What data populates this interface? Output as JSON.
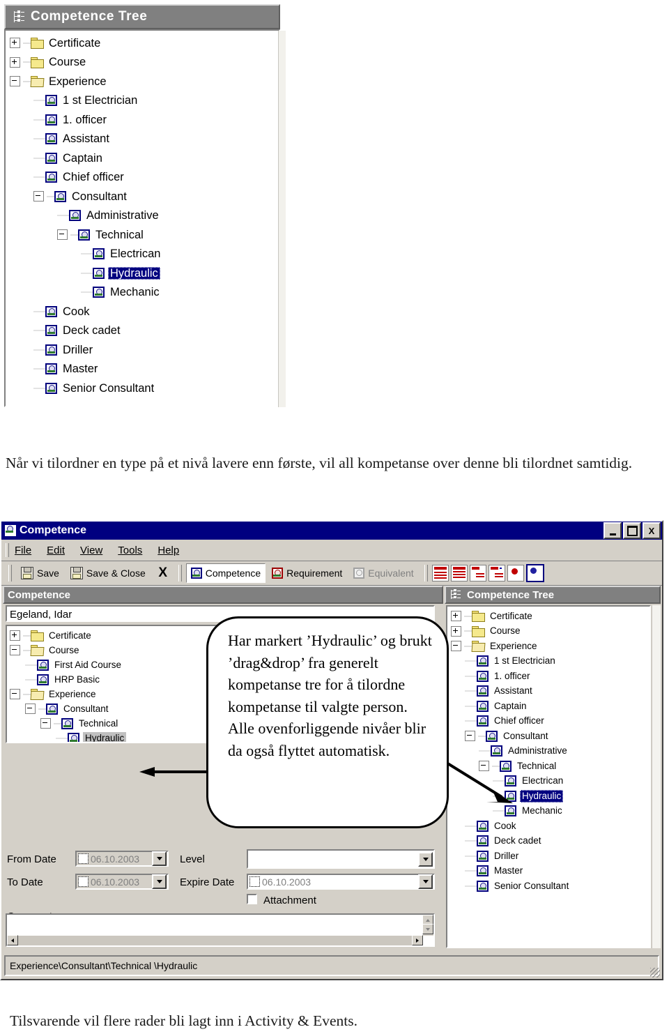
{
  "top_tree_panel": {
    "title": "Competence Tree",
    "title_icon": "tree-outline-icon",
    "nodes": [
      {
        "label": "Certificate",
        "icon": "folder-icon",
        "toggle": "plus",
        "depth": 0
      },
      {
        "label": "Course",
        "icon": "folder-icon",
        "toggle": "plus",
        "depth": 0
      },
      {
        "label": "Experience",
        "icon": "folder-open-icon",
        "toggle": "minus",
        "depth": 0
      },
      {
        "label": "1 st Electrician",
        "icon": "competence-icon",
        "toggle": "none",
        "depth": 1
      },
      {
        "label": "1. officer",
        "icon": "competence-icon",
        "toggle": "none",
        "depth": 1
      },
      {
        "label": "Assistant",
        "icon": "competence-icon",
        "toggle": "none",
        "depth": 1
      },
      {
        "label": "Captain",
        "icon": "competence-icon",
        "toggle": "none",
        "depth": 1
      },
      {
        "label": "Chief officer",
        "icon": "competence-icon",
        "toggle": "none",
        "depth": 1
      },
      {
        "label": "Consultant",
        "icon": "competence-icon",
        "toggle": "minus",
        "depth": 1
      },
      {
        "label": "Administrative",
        "icon": "competence-icon",
        "toggle": "none",
        "depth": 2
      },
      {
        "label": "Technical",
        "icon": "competence-icon",
        "toggle": "minus",
        "depth": 2
      },
      {
        "label": "Electrican",
        "icon": "competence-icon",
        "toggle": "none",
        "depth": 3
      },
      {
        "label": "Hydraulic",
        "icon": "competence-icon",
        "toggle": "none",
        "depth": 3,
        "selected": true
      },
      {
        "label": "Mechanic",
        "icon": "competence-icon",
        "toggle": "none",
        "depth": 3
      },
      {
        "label": "Cook",
        "icon": "competence-icon",
        "toggle": "none",
        "depth": 1
      },
      {
        "label": "Deck cadet",
        "icon": "competence-icon",
        "toggle": "none",
        "depth": 1
      },
      {
        "label": "Driller",
        "icon": "competence-icon",
        "toggle": "none",
        "depth": 1
      },
      {
        "label": "Master",
        "icon": "competence-icon",
        "toggle": "none",
        "depth": 1
      },
      {
        "label": "Senior Consultant",
        "icon": "competence-icon",
        "toggle": "none",
        "depth": 1
      }
    ]
  },
  "paragraph_above": "Når vi tilordner en type på et nivå lavere enn første, vil all kompetanse over denne bli tilordnet samtidig.",
  "paragraph_below": "Tilsvarende vil flere rader bli lagt inn i Activity & Events.",
  "app": {
    "title": "Competence",
    "window_buttons": {
      "minimize": "_",
      "maximize": "□",
      "close": "X"
    },
    "menu": [
      "File",
      "Edit",
      "View",
      "Tools",
      "Help"
    ],
    "toolbar": {
      "save": "Save",
      "save_and_close": "Save & Close",
      "delete": "X",
      "competence": "Competence",
      "requirement": "Requirement",
      "equivalent": "Equivalent",
      "grid_icons": [
        "list-report-icon",
        "list-report-2-icon",
        "hierarchy-icon",
        "hierarchy-new-icon",
        "competence-red-icon",
        "competence-blue-icon"
      ]
    },
    "left_pane": {
      "title": "Competence",
      "person_name": "Egeland, Idar",
      "tree": [
        {
          "label": "Certificate",
          "icon": "folder-icon",
          "toggle": "plus",
          "depth": 0
        },
        {
          "label": "Course",
          "icon": "folder-open-icon",
          "toggle": "minus",
          "depth": 0
        },
        {
          "label": "First Aid Course",
          "icon": "competence-icon",
          "toggle": "none",
          "depth": 1
        },
        {
          "label": "HRP Basic",
          "icon": "competence-icon",
          "toggle": "none",
          "depth": 1
        },
        {
          "label": "Experience",
          "icon": "folder-open-icon",
          "toggle": "minus",
          "depth": 0
        },
        {
          "label": "Consultant",
          "icon": "competence-icon",
          "toggle": "minus",
          "depth": 1
        },
        {
          "label": "Technical",
          "icon": "competence-icon",
          "toggle": "minus",
          "depth": 2
        },
        {
          "label": "Hydraulic",
          "icon": "competence-icon",
          "toggle": "none",
          "depth": 3,
          "highlighted": true
        }
      ],
      "form": {
        "from_date_label": "From Date",
        "from_date_value": "06.10.2003",
        "to_date_label": "To Date",
        "to_date_value": "06.10.2003",
        "level_label": "Level",
        "level_value": "",
        "expire_date_label": "Expire Date",
        "expire_date_value": "06.10.2003",
        "attachment_label": "Attachment",
        "attachment_checked": false,
        "comments_label": "Comments",
        "comments_value": ""
      }
    },
    "right_pane": {
      "title": "Competence Tree",
      "title_icon": "tree-outline-icon",
      "tree": [
        {
          "label": "Certificate",
          "icon": "folder-icon",
          "toggle": "plus",
          "depth": 0
        },
        {
          "label": "Course",
          "icon": "folder-icon",
          "toggle": "plus",
          "depth": 0
        },
        {
          "label": "Experience",
          "icon": "folder-open-icon",
          "toggle": "minus",
          "depth": 0
        },
        {
          "label": "1 st Electrician",
          "icon": "competence-icon",
          "toggle": "none",
          "depth": 1
        },
        {
          "label": "1. officer",
          "icon": "competence-icon",
          "toggle": "none",
          "depth": 1
        },
        {
          "label": "Assistant",
          "icon": "competence-icon",
          "toggle": "none",
          "depth": 1
        },
        {
          "label": "Captain",
          "icon": "competence-icon",
          "toggle": "none",
          "depth": 1
        },
        {
          "label": "Chief officer",
          "icon": "competence-icon",
          "toggle": "none",
          "depth": 1
        },
        {
          "label": "Consultant",
          "icon": "competence-icon",
          "toggle": "minus",
          "depth": 1
        },
        {
          "label": "Administrative",
          "icon": "competence-icon",
          "toggle": "none",
          "depth": 2
        },
        {
          "label": "Technical",
          "icon": "competence-icon",
          "toggle": "minus",
          "depth": 2
        },
        {
          "label": "Electrican",
          "icon": "competence-icon",
          "toggle": "none",
          "depth": 3
        },
        {
          "label": "Hydraulic",
          "icon": "competence-icon",
          "toggle": "none",
          "depth": 3,
          "selected": true
        },
        {
          "label": "Mechanic",
          "icon": "competence-icon",
          "toggle": "none",
          "depth": 3
        },
        {
          "label": "Cook",
          "icon": "competence-icon",
          "toggle": "none",
          "depth": 1
        },
        {
          "label": "Deck cadet",
          "icon": "competence-icon",
          "toggle": "none",
          "depth": 1
        },
        {
          "label": "Driller",
          "icon": "competence-icon",
          "toggle": "none",
          "depth": 1
        },
        {
          "label": "Master",
          "icon": "competence-icon",
          "toggle": "none",
          "depth": 1
        },
        {
          "label": "Senior Consultant",
          "icon": "competence-icon",
          "toggle": "none",
          "depth": 1
        }
      ]
    },
    "status_bar": "Experience\\Consultant\\Technical \\Hydraulic"
  },
  "callout": {
    "text": "Har markert ’Hydraulic’ og brukt ’drag&drop’ fra generelt kompetanse tre for å tilordne kompetanse til valgte person. Alle ovenforliggende nivåer blir da også flyttet automatisk."
  },
  "colors": {
    "title_bar": "#000080",
    "panel_header": "#808080",
    "window_face": "#d4d0c8",
    "selection": "#000080",
    "highlight_gray": "#c0c0c0"
  }
}
